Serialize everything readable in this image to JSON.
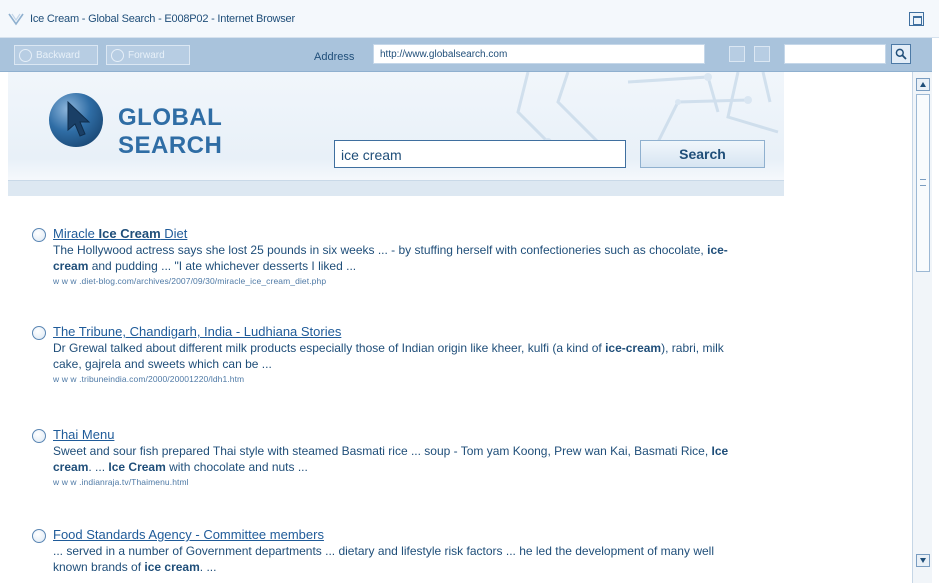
{
  "window": {
    "title": "Ice Cream - Global Search - E008P02 - Internet Browser"
  },
  "toolbar": {
    "back_label": "Backward",
    "forward_label": "Forward",
    "address_label": "Address",
    "address_value": "http://www.globalsearch.com",
    "search_value": ""
  },
  "site": {
    "logo_line1": "GLOBAL",
    "logo_line2": "SEARCH",
    "search_value": "ice cream",
    "search_button": "Search"
  },
  "results": [
    {
      "title_pre": "Miracle ",
      "title_kw": "Ice Cream",
      "title_post": " Diet",
      "snippet": [
        {
          "t": "The Hollywood actress says she lost 25 pounds in six weeks ... - by stuffing herself with confectioneries such as chocolate, "
        },
        {
          "k": "ice-cream"
        },
        {
          "t": " and pudding ... \"I ate whichever desserts I liked ..."
        }
      ],
      "url": "w w w .diet-blog.com/archives/2007/09/30/miracle_ice_cream_diet.php"
    },
    {
      "title_pre": "The Tribune, Chandigarh, India - Ludhiana Stories",
      "title_kw": "",
      "title_post": "",
      "snippet": [
        {
          "t": "Dr Grewal talked about different milk products especially those of Indian origin like kheer, kulfi (a kind of "
        },
        {
          "k": "ice-cream"
        },
        {
          "t": "), rabri, milk cake, gajrela and sweets which can be ..."
        }
      ],
      "url": "w w w .tribuneindia.com/2000/20001220/ldh1.htm"
    },
    {
      "title_pre": "Thai Menu",
      "title_kw": "",
      "title_post": "",
      "snippet": [
        {
          "t": "Sweet and sour fish prepared Thai style with steamed Basmati rice ... soup - Tom yam Koong, Prew wan Kai, Basmati Rice, "
        },
        {
          "k": "Ice cream"
        },
        {
          "t": ". ... "
        },
        {
          "k": "Ice Cream"
        },
        {
          "t": " with chocolate and nuts ..."
        }
      ],
      "url": "w w w .indianraja.tv/Thaimenu.html"
    },
    {
      "title_pre": "Food Standards Agency - Committee members",
      "title_kw": "",
      "title_post": "",
      "snippet": [
        {
          "t": "... served in a number of Government departments ... dietary and lifestyle risk factors ... he led the development of many well known brands of "
        },
        {
          "k": "ice cream"
        },
        {
          "t": ". ..."
        }
      ],
      "url": ""
    }
  ],
  "colors": {
    "accent": "#2f6da5",
    "text": "#1f4e79",
    "toolbar": "#a9c3dc"
  }
}
